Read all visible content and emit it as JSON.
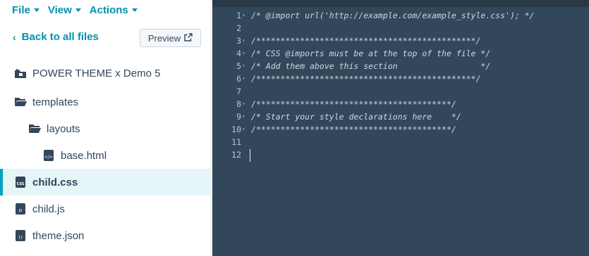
{
  "menu": {
    "file": "File",
    "view": "View",
    "actions": "Actions"
  },
  "nav": {
    "back": "Back to all files",
    "preview": "Preview"
  },
  "tree": [
    {
      "label": "POWER THEME x Demo 5",
      "icon": "theme-icon"
    },
    {
      "label": "templates",
      "icon": "folder-open-icon"
    },
    {
      "label": "layouts",
      "icon": "folder-open-icon"
    },
    {
      "label": "base.html",
      "icon": "html-file-icon"
    },
    {
      "label": "child.css",
      "icon": "css-file-icon",
      "active": true
    },
    {
      "label": "child.js",
      "icon": "js-file-icon"
    },
    {
      "label": "theme.json",
      "icon": "json-file-icon"
    }
  ],
  "colors": {
    "accent": "#0091ae",
    "editor_bg": "#33475b",
    "active_bg": "#e5f5f8"
  },
  "editor": {
    "lines": [
      {
        "n": "1",
        "fold": true,
        "text": "/* @import url('http://example.com/example_style.css'); */"
      },
      {
        "n": "2",
        "fold": false,
        "text": ""
      },
      {
        "n": "3",
        "fold": true,
        "text": "/*********************************************/"
      },
      {
        "n": "4",
        "fold": true,
        "text": "/* CSS @imports must be at the top of the file */"
      },
      {
        "n": "5",
        "fold": true,
        "text": "/* Add them above this section                 */"
      },
      {
        "n": "6",
        "fold": true,
        "text": "/*********************************************/"
      },
      {
        "n": "7",
        "fold": false,
        "text": ""
      },
      {
        "n": "8",
        "fold": true,
        "text": "/****************************************/"
      },
      {
        "n": "9",
        "fold": true,
        "text": "/* Start your style declarations here    */"
      },
      {
        "n": "10",
        "fold": true,
        "text": "/****************************************/"
      },
      {
        "n": "11",
        "fold": false,
        "text": ""
      },
      {
        "n": "12",
        "fold": false,
        "text": ""
      }
    ]
  }
}
